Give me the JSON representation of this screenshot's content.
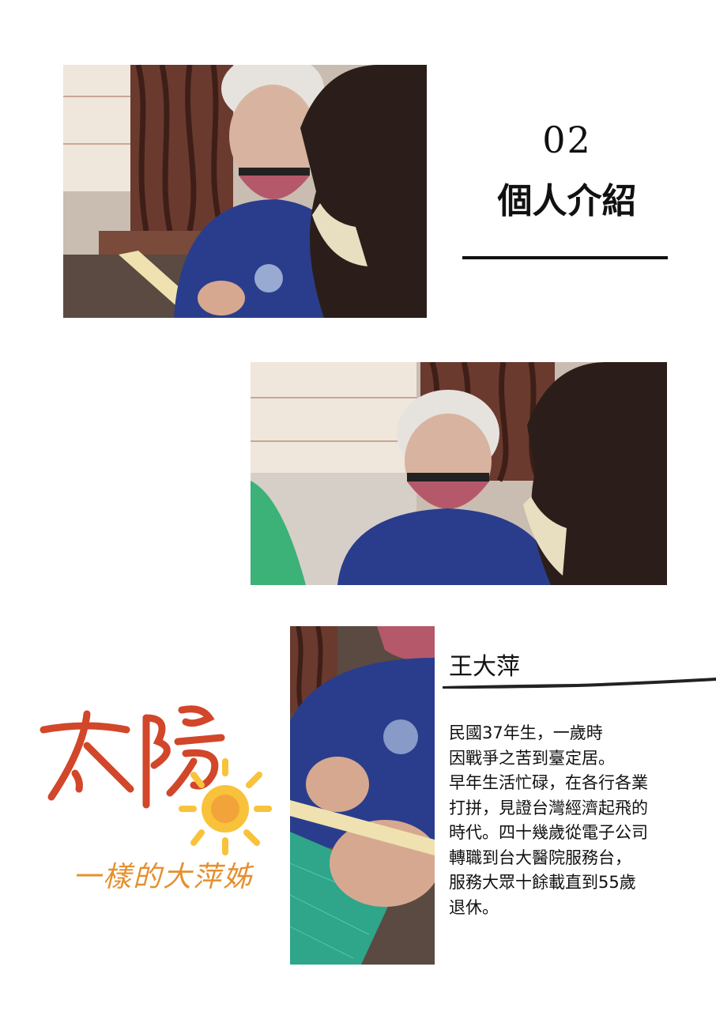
{
  "header": {
    "section_number": "02",
    "section_title": "個人介紹"
  },
  "profile": {
    "name": "王大萍",
    "bio_lines": [
      "民國37年生，一歲時",
      "因戰爭之苦到臺定居。",
      "早年生活忙碌，在各行各業",
      "打拼，見證台灣經濟起飛的",
      "時代。四十幾歲從電子公司",
      "轉職到台大醫院服務台，",
      "服務大眾十餘載直到55歲",
      "退休。"
    ]
  },
  "logo": {
    "main_text": "太陽",
    "sub_text": "一樣的大萍姊"
  },
  "photos": [
    {
      "name": "photo-writing-closeup"
    },
    {
      "name": "photo-smiling-portrait"
    },
    {
      "name": "photo-hands-crafting"
    }
  ],
  "colors": {
    "accent_red": "#d2462a",
    "accent_orange": "#f2a43a",
    "sun_yellow": "#f8c23a",
    "shirt_blue": "#2a3d8c",
    "mask_pink": "#b5596a"
  }
}
